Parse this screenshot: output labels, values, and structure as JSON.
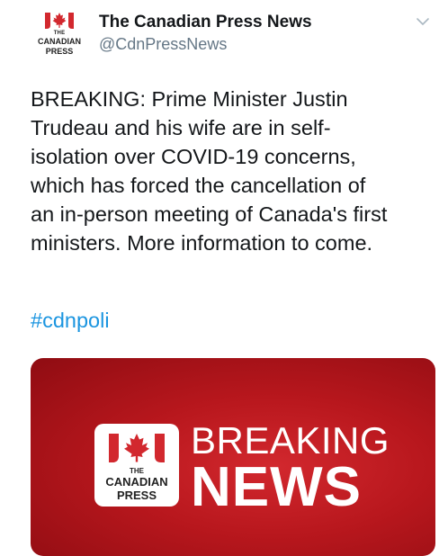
{
  "tweet": {
    "author": {
      "display_name": "The Canadian Press News",
      "handle": "@CdnPressNews",
      "avatar_logo": {
        "the": "THE",
        "canadian": "CANADIAN",
        "press": "PRESS"
      }
    },
    "menu_icon": "chevron-down-icon",
    "text": "BREAKING: Prime Minister Justin\nTrudeau and his wife are in self-\nisolation over COVID-19 concerns,\nwhich has forced the cancellation of\nan in-person meeting of Canada's first\nministers. More information to come.",
    "hashtag": "#cdnpoli",
    "media": {
      "logo": {
        "the": "THE",
        "canadian": "CANADIAN",
        "press": "PRESS"
      },
      "headline_top": "BREAKING",
      "headline_bottom": "NEWS"
    }
  },
  "colors": {
    "brand_red": "#d2282e",
    "hashtag_blue": "#1b95e0",
    "handle_gray": "#657786"
  }
}
